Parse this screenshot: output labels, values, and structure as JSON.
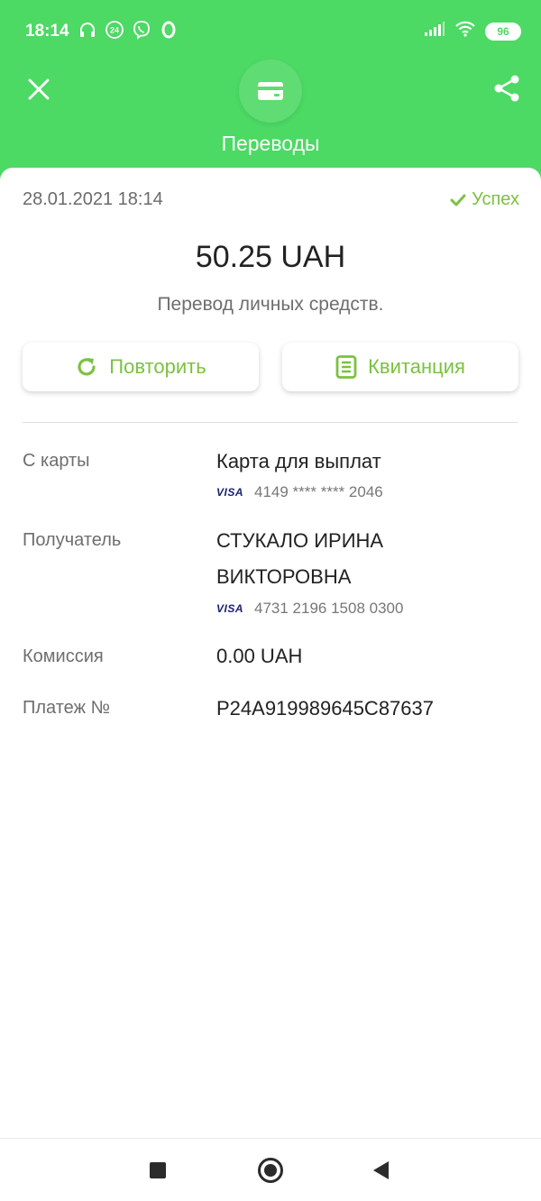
{
  "status_bar": {
    "time": "18:14",
    "badge_24": "24",
    "battery": "96"
  },
  "header": {
    "title": "Переводы"
  },
  "transaction": {
    "date": "28.01.2021 18:14",
    "status": "Успех",
    "amount": "50.25 UAH",
    "description": "Перевод личных средств."
  },
  "actions": {
    "repeat_label": "Повторить",
    "receipt_label": "Квитанция"
  },
  "details": {
    "from_card_label": "С карты",
    "from_card_name": "Карта для выплат",
    "from_card_brand": "VISA",
    "from_card_number": "4149 **** **** 2046",
    "recipient_label": "Получатель",
    "recipient_name_line1": "СТУКАЛО ИРИНА",
    "recipient_name_line2": "ВИКТОРОВНА",
    "recipient_card_brand": "VISA",
    "recipient_card_number": "4731 2196 1508 0300",
    "commission_label": "Комиссия",
    "commission_value": "0.00 UAH",
    "payment_label": "Платеж №",
    "payment_value": "P24A919989645C87637"
  },
  "colors": {
    "brand_green": "#4cd964",
    "accent_green": "#7bc142"
  },
  "icons": [
    "close-icon",
    "wallet-icon",
    "share-icon",
    "check-icon",
    "refresh-icon",
    "receipt-icon"
  ]
}
